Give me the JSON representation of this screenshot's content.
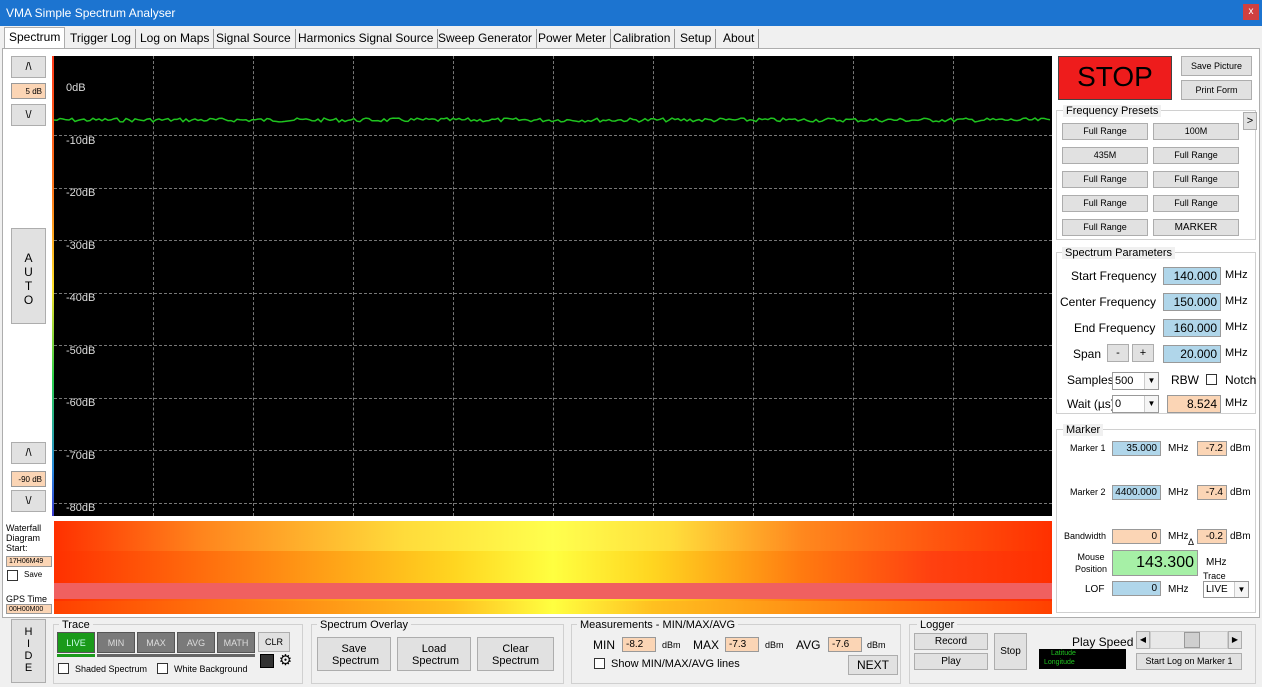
{
  "window": {
    "title": "VMA Simple Spectrum Analyser",
    "close": "x"
  },
  "tabs": [
    "Spectrum",
    "Trigger Log",
    "Log on Maps",
    "Signal Source",
    "Harmonics Signal Source",
    "Sweep Generator",
    "Power Meter",
    "Calibration",
    "Setup",
    "About"
  ],
  "left": {
    "top_up": "/\\",
    "top_val": "5 dB",
    "top_down": "\\/",
    "auto": "AUTO",
    "bot_up": "/\\",
    "bot_val": "-90 dB",
    "bot_down": "\\/",
    "waterfall_label": "Waterfall Diagram Start:",
    "waterfall_time": "17H06M49",
    "save": "Save",
    "gps_label": "GPS Time",
    "gps_time": "00H00M00",
    "hide": "HIDE"
  },
  "plot": {
    "db_labels": [
      "0dB",
      "-10dB",
      "-20dB",
      "-30dB",
      "-40dB",
      "-50dB",
      "-60dB",
      "-70dB",
      "-80dB"
    ],
    "trace_color": "#1fc41f"
  },
  "right": {
    "stop": "STOP",
    "save_picture": "Save Picture",
    "print_form": "Print Form",
    "presets_title": "Frequency Presets",
    "presets_arrow": ">",
    "presets": [
      "Full Range",
      "100M",
      "435M",
      "Full Range",
      "Full Range",
      "Full Range",
      "Full Range",
      "Full Range",
      "Full Range",
      "MARKER"
    ],
    "params_title": "Spectrum Parameters",
    "start_label": "Start Frequency",
    "start_val": "140.000",
    "center_label": "Center Frequency",
    "center_val": "150.000",
    "end_label": "End Frequency",
    "end_val": "160.000",
    "span_label": "Span",
    "span_minus": "-",
    "span_plus": "+",
    "span_val": "20.000",
    "mhz": "MHz",
    "samples_label": "Samples",
    "samples_val": "500",
    "rbw_label": "RBW",
    "notch_label": "Notch",
    "wait_label": "Wait (µs)",
    "wait_val": "0",
    "rbw_val": "8.524",
    "marker_title": "Marker",
    "m1_label": "Marker 1",
    "m1_freq": "35.000",
    "m1_dbm": "-7.2",
    "m2_label": "Marker 2",
    "m2_freq": "4400.000",
    "m2_dbm": "-7.4",
    "dbm": "dBm",
    "bw_label": "Bandwidth",
    "bw_val": "0",
    "bw_dbm": "-0.2",
    "delta": "Δ",
    "mouse_label": "Mouse Position",
    "mouse_val": "143.300",
    "trace_label": "Trace",
    "trace_val": "LIVE",
    "lof_label": "LOF",
    "lof_val": "0"
  },
  "bottom": {
    "trace_title": "Trace",
    "trace_btns": [
      "LIVE",
      "MIN",
      "MAX",
      "AVG",
      "MATH"
    ],
    "clr": "CLR",
    "shaded": "Shaded Spectrum",
    "white_bg": "White Background",
    "overlay_title": "Spectrum Overlay",
    "save_spectrum": "Save Spectrum",
    "load_spectrum": "Load Spectrum",
    "clear_spectrum": "Clear Spectrum",
    "meas_title": "Measurements - MIN/MAX/AVG",
    "min_label": "MIN",
    "min_val": "-8.2",
    "max_label": "MAX",
    "max_val": "-7.3",
    "avg_label": "AVG",
    "avg_val": "-7.6",
    "dbm": "dBm",
    "show_lines": "Show MIN/MAX/AVG lines",
    "next": "NEXT",
    "logger_title": "Logger",
    "record": "Record",
    "play": "Play",
    "stop": "Stop",
    "latitude": "Latitude",
    "longitude": "Longitude",
    "play_speed": "Play Speed",
    "slider_left": "◀",
    "slider_right": "▶",
    "start_log": "Start Log on Marker 1"
  }
}
